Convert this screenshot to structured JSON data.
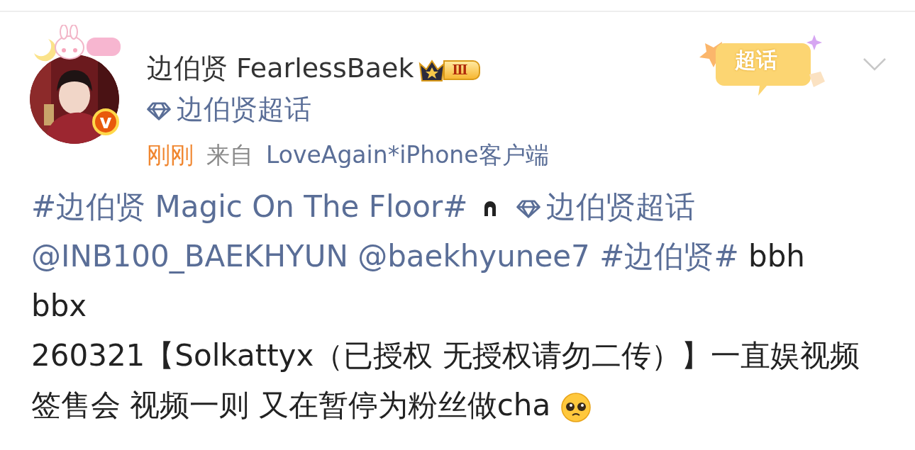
{
  "post": {
    "author": {
      "name": "边伯贤 FearlessBaek",
      "verified_badge": "v",
      "level_badge": "Ⅲ",
      "supertopic_link": "边伯贤超话"
    },
    "meta": {
      "time": "刚刚",
      "source_prefix": "来自",
      "source": "LoveAgain*iPhone客户端"
    },
    "sticker": "超话",
    "paragraphs": [
      [
        {
          "kind": "topic",
          "text": "#边伯贤 Magic On The Floor#"
        },
        {
          "kind": "glyph-icon"
        },
        {
          "kind": "supertopic",
          "text": "边伯贤超话"
        },
        {
          "kind": "mention",
          "text": "@INB100_BAEKHYUN"
        },
        {
          "kind": "mention",
          "text": "@baekhyunee7"
        },
        {
          "kind": "topic",
          "text": "#边伯贤#"
        },
        {
          "kind": "text",
          "text": "bbh bbx"
        }
      ],
      [
        {
          "kind": "text",
          "text": "260321【Solkattyx（已授权 无授权请勿二传）】一直娱视频签售会 视频一则 又在暂停为粉丝做cha"
        },
        {
          "kind": "emoji-icon"
        }
      ]
    ]
  }
}
